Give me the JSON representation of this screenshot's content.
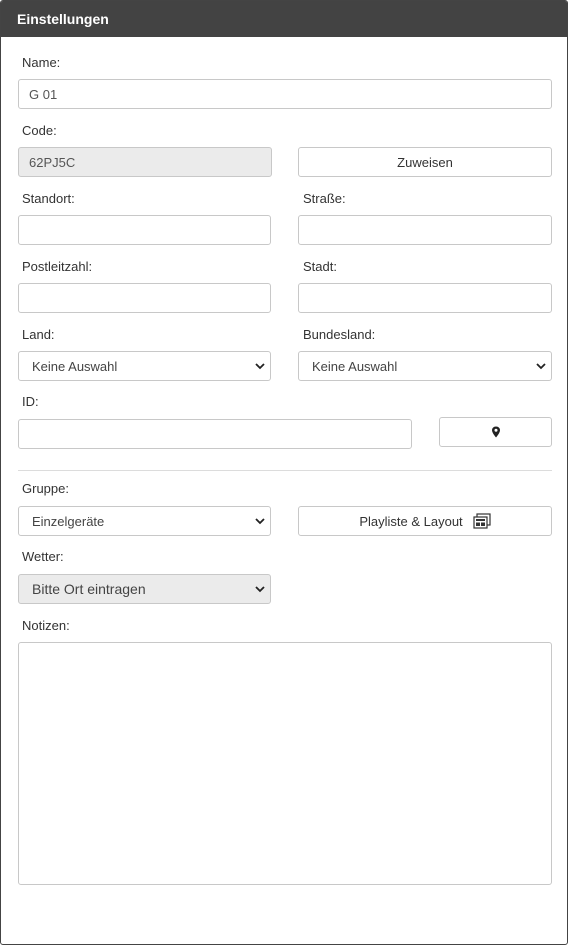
{
  "header": {
    "title": "Einstellungen"
  },
  "form": {
    "name_label": "Name:",
    "name_value": "G 01",
    "code_label": "Code:",
    "code_value": "62PJ5C",
    "assign_button": "Zuweisen",
    "location_label": "Standort:",
    "location_value": "",
    "street_label": "Straße:",
    "street_value": "",
    "postal_label": "Postleitzahl:",
    "postal_value": "",
    "city_label": "Stadt:",
    "city_value": "",
    "country_label": "Land:",
    "country_selected": "Keine Auswahl",
    "state_label": "Bundesland:",
    "state_selected": "Keine Auswahl",
    "id_label": "ID:",
    "id_value": "",
    "group_label": "Gruppe:",
    "group_selected": "Einzelgeräte",
    "playlist_button": "Playliste & Layout",
    "weather_label": "Wetter:",
    "weather_selected": "Bitte Ort eintragen",
    "notes_label": "Notizen:",
    "notes_value": ""
  },
  "icons": {
    "location_pin": "map-pin-icon",
    "playlist": "playlist-layout-icon",
    "chevron": "chevron-down-icon"
  },
  "colors": {
    "header_bg": "#434343",
    "disabled_bg": "#ebebeb",
    "border": "#c8c8c8"
  }
}
